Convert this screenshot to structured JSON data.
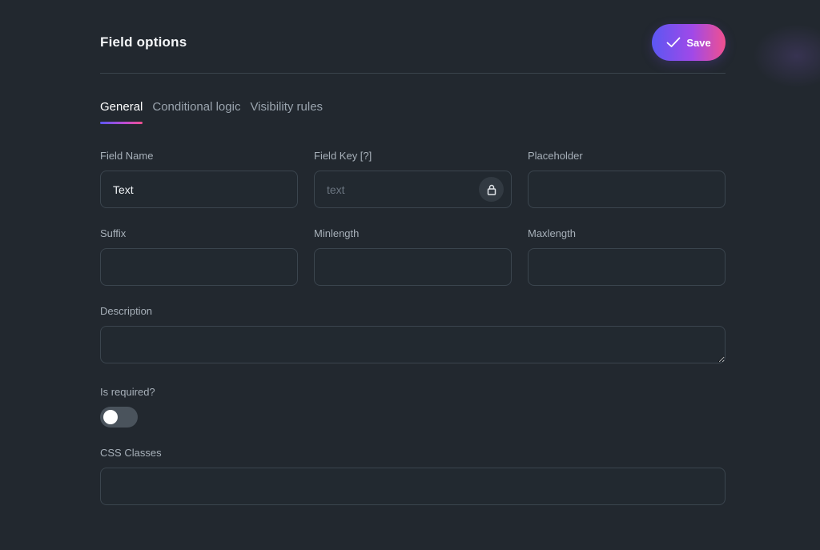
{
  "header": {
    "title": "Field options",
    "save_label": "Save"
  },
  "tabs": [
    {
      "label": "General",
      "active": true
    },
    {
      "label": "Conditional logic",
      "active": false
    },
    {
      "label": "Visibility rules",
      "active": false
    }
  ],
  "fields": {
    "field_name": {
      "label": "Field Name",
      "value": "Text"
    },
    "field_key": {
      "label": "Field Key [?]",
      "value": "text",
      "locked": true
    },
    "placeholder": {
      "label": "Placeholder",
      "value": ""
    },
    "suffix": {
      "label": "Suffix",
      "value": ""
    },
    "minlength": {
      "label": "Minlength",
      "value": ""
    },
    "maxlength": {
      "label": "Maxlength",
      "value": ""
    },
    "description": {
      "label": "Description",
      "value": ""
    },
    "is_required": {
      "label": "Is required?",
      "on": false
    },
    "css_classes": {
      "label": "CSS Classes",
      "value": ""
    }
  },
  "icons": {
    "save": "check-icon",
    "field_key": "lock-icon"
  },
  "colors": {
    "background": "#22282f",
    "accent_start": "#5b57f2",
    "accent_end": "#f0508f"
  }
}
